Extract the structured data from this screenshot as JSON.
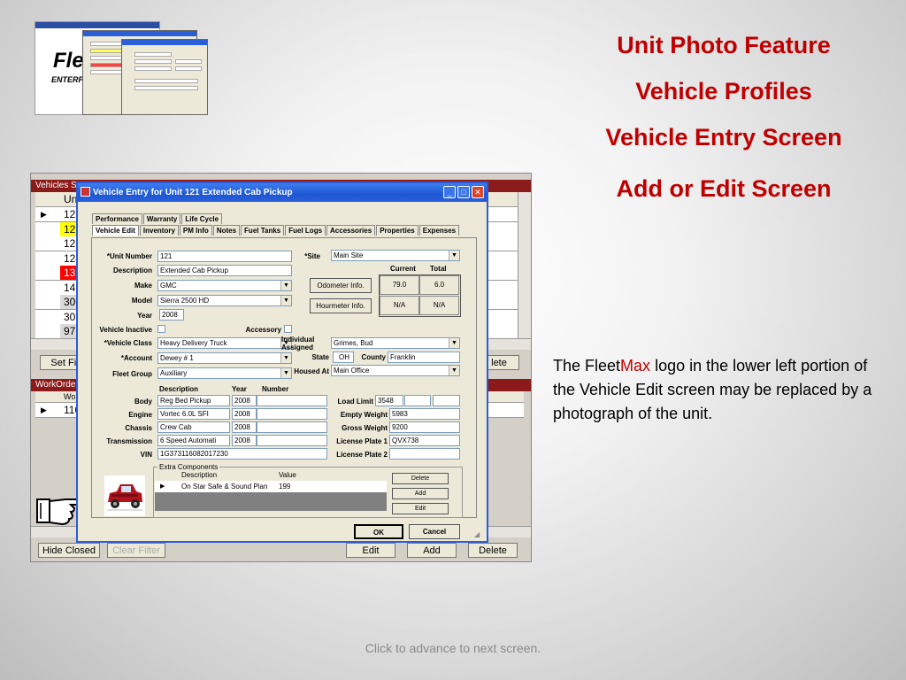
{
  "slide": {
    "titles": [
      "Unit Photo Feature",
      "Vehicle Profiles",
      "Vehicle Entry Screen",
      "Add or Edit Screen"
    ],
    "caption_prefix": "The Fleet",
    "caption_brand": "Max",
    "caption_rest": " logo in the lower left portion of the Vehicle Edit screen may be replaced by a photograph of the unit.",
    "footer": "Click to advance to next screen.",
    "thumb_logo": "Flee",
    "thumb_sub": "ENTERPRIS",
    "colors": {
      "title": "#c00000",
      "brand": "#c00000"
    }
  },
  "bg_window": {
    "title": "Vehicles Se",
    "col_header": "Uni",
    "rows": [
      {
        "unit": "121",
        "color": "#ffffff"
      },
      {
        "unit": "122",
        "color": "#ffff00"
      },
      {
        "unit": "123",
        "color": "#ffffff"
      },
      {
        "unit": "124",
        "color": "#ffffff"
      },
      {
        "unit": "131",
        "color": "#ff0000"
      },
      {
        "unit": "141",
        "color": "#ffffff"
      },
      {
        "unit": "300",
        "color": "#d9d9d9"
      },
      {
        "unit": "301",
        "color": "#ffffff"
      },
      {
        "unit": "97",
        "color": "#d9d9d9"
      }
    ],
    "set_filter": "Set Fil",
    "delete_top": "lete",
    "workorders_title": "WorkOrders",
    "wo_col": "Work",
    "wo_row": "110",
    "hide_closed": "Hide Closed",
    "clear_filter": "Clear Filter",
    "edit": "Edit",
    "add": "Add",
    "delete": "Delete"
  },
  "dialog": {
    "title": "Vehicle Entry for Unit 121 Extended Cab Pickup",
    "tabs_row1": [
      "Performance",
      "Warranty",
      "Life Cycle"
    ],
    "tabs_row2": [
      "Vehicle Edit",
      "Inventory",
      "PM Info",
      "Notes",
      "Fuel Tanks",
      "Fuel Logs",
      "Accessories",
      "Properties",
      "Expenses"
    ],
    "labels": {
      "unit_number": "*Unit Number",
      "description": "Description",
      "make": "Make",
      "model": "Model",
      "year": "Year",
      "vehicle_inactive": "Vehicle Inactive",
      "accessory": "Accessory",
      "vehicle_class": "*Vehicle Class",
      "account": "*Account",
      "fleet_group": "Fleet Group",
      "site": "*Site",
      "current": "Current",
      "total": "Total",
      "individual": "Individual",
      "assigned": "Assigned",
      "state": "State",
      "county": "County",
      "housed_at": "Housed At",
      "col_description": "Description",
      "col_year": "Year",
      "col_number": "Number",
      "body": "Body",
      "engine": "Engine",
      "chassis": "Chassis",
      "transmission": "Transmission",
      "vin": "VIN",
      "load_limit": "Load Limit",
      "empty_weight": "Empty Weight",
      "gross_weight": "Gross Weight",
      "license_plate_1": "License Plate 1",
      "license_plate_2": "License Plate 2",
      "extra_components": "Extra Components",
      "ec_description": "Description",
      "ec_value": "Value"
    },
    "values": {
      "unit_number": "121",
      "description": "Extended Cab Pickup",
      "make": "GMC",
      "model": "Sierra 2500 HD",
      "year": "2008",
      "vehicle_class": "Heavy Delivery Truck",
      "account": "Dewey  # 1",
      "fleet_group": "Auxiliary",
      "site": "Main Site",
      "odometer_current": "79.0",
      "odometer_total": "6.0",
      "hourmeter_current": "N/A",
      "hourmeter_total": "N/A",
      "assigned": "Grimes, Bud",
      "state": "OH",
      "county": "Franklin",
      "housed_at": "Main Office",
      "body_desc": "Reg Bed Pickup",
      "body_year": "2008",
      "engine_desc": "Vortec 6.0L SFI",
      "engine_year": "2008",
      "chassis_desc": "Crew Cab",
      "chassis_year": "2008",
      "trans_desc": "6 Speed Automati",
      "trans_year": "2008",
      "vin": "1G373116082017230",
      "load_limit": "3548",
      "empty_weight": "5983",
      "gross_weight": "9200",
      "license_plate_1": "QVX738",
      "license_plate_2": "",
      "ec_row_desc": "On Star Safe & Sound Plan",
      "ec_row_value": "199"
    },
    "buttons": {
      "odometer": "Odometer Info.",
      "hourmeter": "Hourmeter Info.",
      "ec_delete": "Delete",
      "ec_add": "Add",
      "ec_edit": "Edit",
      "ok": "OK",
      "cancel": "Cancel"
    }
  }
}
